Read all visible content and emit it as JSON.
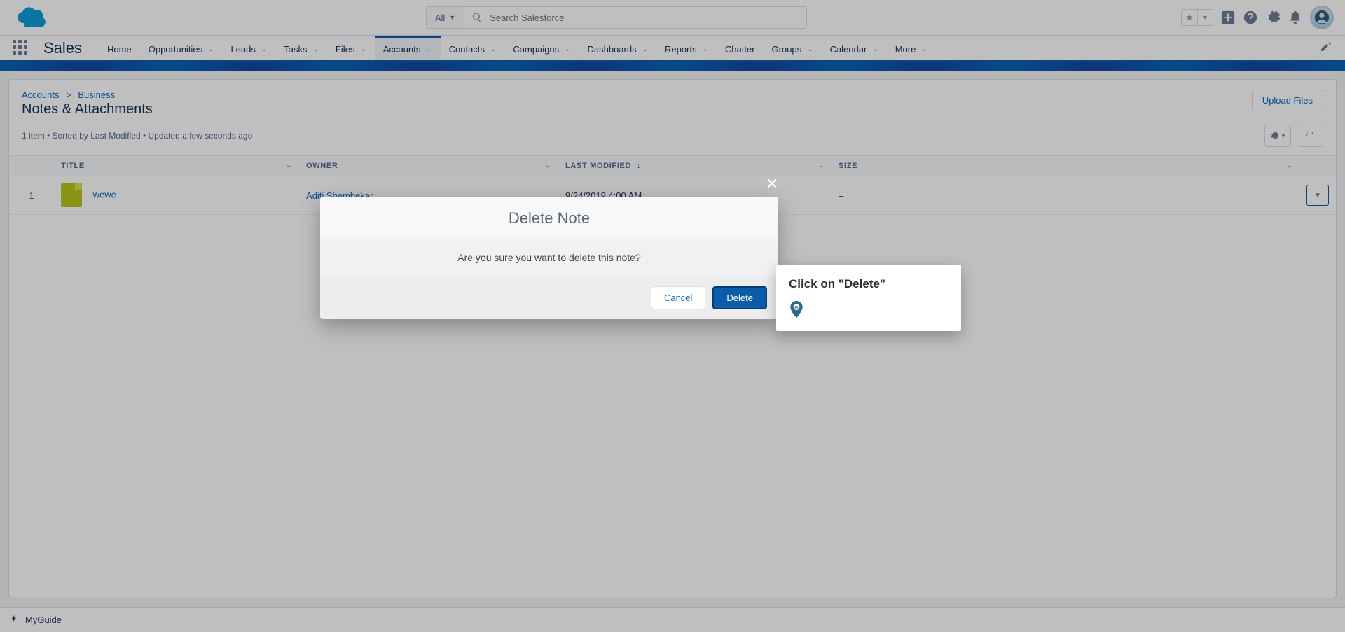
{
  "header": {
    "search_scope": "All",
    "search_placeholder": "Search Salesforce"
  },
  "nav": {
    "app_name": "Sales",
    "items": [
      {
        "label": "Home",
        "chevron": false
      },
      {
        "label": "Opportunities",
        "chevron": true
      },
      {
        "label": "Leads",
        "chevron": true
      },
      {
        "label": "Tasks",
        "chevron": true
      },
      {
        "label": "Files",
        "chevron": true
      },
      {
        "label": "Accounts",
        "chevron": true,
        "active": true
      },
      {
        "label": "Contacts",
        "chevron": true
      },
      {
        "label": "Campaigns",
        "chevron": true
      },
      {
        "label": "Dashboards",
        "chevron": true
      },
      {
        "label": "Reports",
        "chevron": true
      },
      {
        "label": "Chatter",
        "chevron": false
      },
      {
        "label": "Groups",
        "chevron": true
      },
      {
        "label": "Calendar",
        "chevron": true
      },
      {
        "label": "More",
        "chevron": true
      }
    ]
  },
  "page": {
    "breadcrumb1": "Accounts",
    "breadcrumb2": "Business",
    "title": "Notes & Attachments",
    "upload_label": "Upload Files",
    "meta": "1 item • Sorted by Last Modified • Updated a few seconds ago"
  },
  "table": {
    "columns": {
      "title": "TITLE",
      "owner": "OWNER",
      "last_modified": "LAST MODIFIED",
      "size": "SIZE"
    },
    "rows": [
      {
        "num": "1",
        "title": "wewe",
        "owner": "Aditi Shembekar",
        "last_modified": "9/24/2019 4:00 AM",
        "size": "–"
      }
    ]
  },
  "modal": {
    "title": "Delete Note",
    "body": "Are you sure you want to delete this note?",
    "cancel": "Cancel",
    "confirm": "Delete"
  },
  "tooltip": {
    "text": "Click on \"Delete\""
  },
  "statusbar": {
    "label": "MyGuide"
  }
}
